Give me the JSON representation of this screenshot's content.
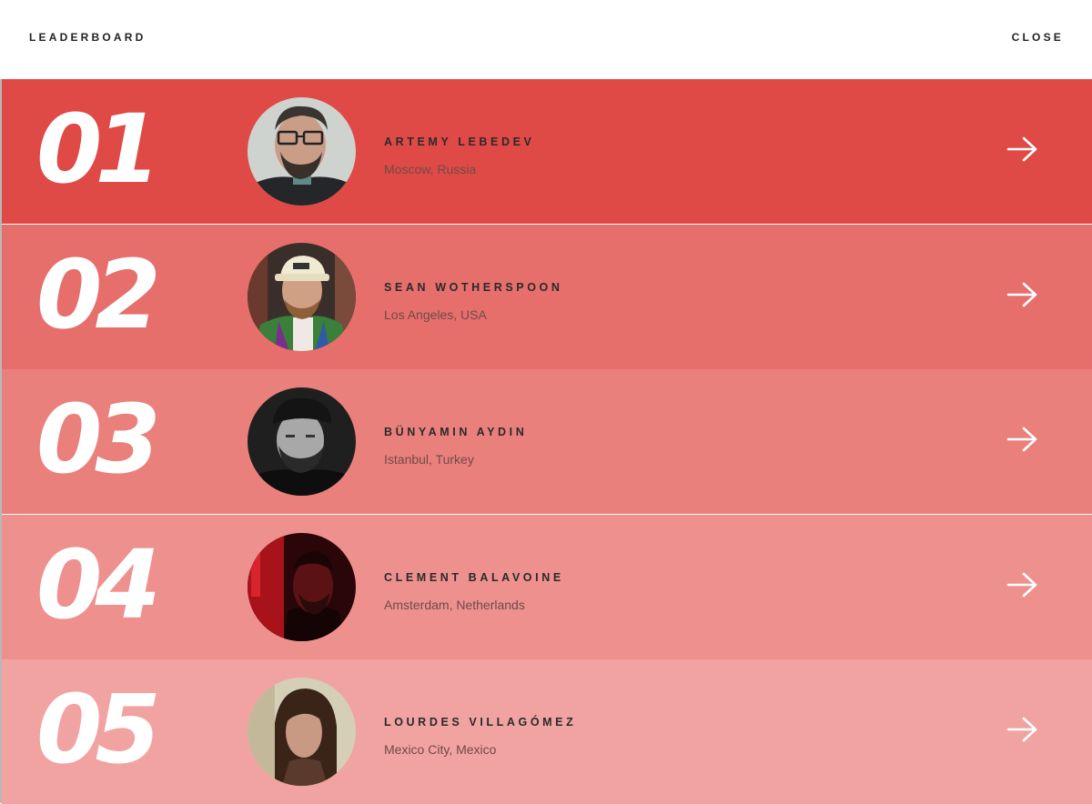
{
  "header": {
    "title": "LEADERBOARD",
    "close_label": "CLOSE"
  },
  "rows": [
    {
      "rank": "01",
      "name": "ARTEMY LEBEDEV",
      "location": "Moscow, Russia",
      "color": "#e04a46",
      "arrow_icon": "arrow-right-icon"
    },
    {
      "rank": "02",
      "name": "SEAN WOTHERSPOON",
      "location": "Los Angeles, USA",
      "color": "#e66f6c",
      "arrow_icon": "arrow-right-icon"
    },
    {
      "rank": "03",
      "name": "BÜNYAMIN AYDIN",
      "location": "Istanbul, Turkey",
      "color": "#ea807c",
      "arrow_icon": "arrow-right-icon"
    },
    {
      "rank": "04",
      "name": "CLEMENT BALAVOINE",
      "location": "Amsterdam, Netherlands",
      "color": "#ee918e",
      "arrow_icon": "arrow-right-icon"
    },
    {
      "rank": "05",
      "name": "LOURDES VILLAGÓMEZ",
      "location": "Mexico City, Mexico",
      "color": "#f1a3a1",
      "arrow_icon": "arrow-right-icon"
    }
  ]
}
